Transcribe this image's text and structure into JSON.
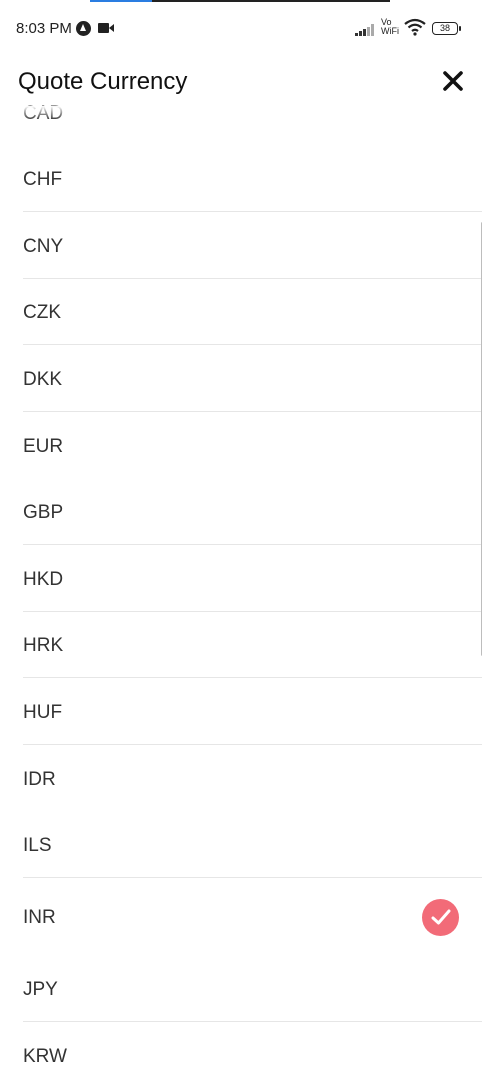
{
  "status_bar": {
    "time": "8:03 PM",
    "network_label_top": "Vo",
    "network_label_bottom": "WiFi",
    "battery": "38",
    "icons": [
      "app-icon",
      "video-camera-icon",
      "signal-icon",
      "wifi-icon",
      "battery-icon"
    ]
  },
  "header": {
    "title": "Quote Currency",
    "close_icon": "close-icon"
  },
  "currencies": [
    {
      "code": "CAD"
    },
    {
      "code": "CHF"
    },
    {
      "code": "CNY"
    },
    {
      "code": "CZK"
    },
    {
      "code": "DKK"
    },
    {
      "code": "EUR"
    },
    {
      "code": "GBP"
    },
    {
      "code": "HKD"
    },
    {
      "code": "HRK"
    },
    {
      "code": "HUF"
    },
    {
      "code": "IDR"
    },
    {
      "code": "ILS"
    },
    {
      "code": "INR",
      "selected": true
    },
    {
      "code": "JPY"
    },
    {
      "code": "KRW"
    }
  ],
  "selected_code": "INR",
  "colors": {
    "accent": "#f26b78",
    "divider": "#e6e6e6"
  }
}
